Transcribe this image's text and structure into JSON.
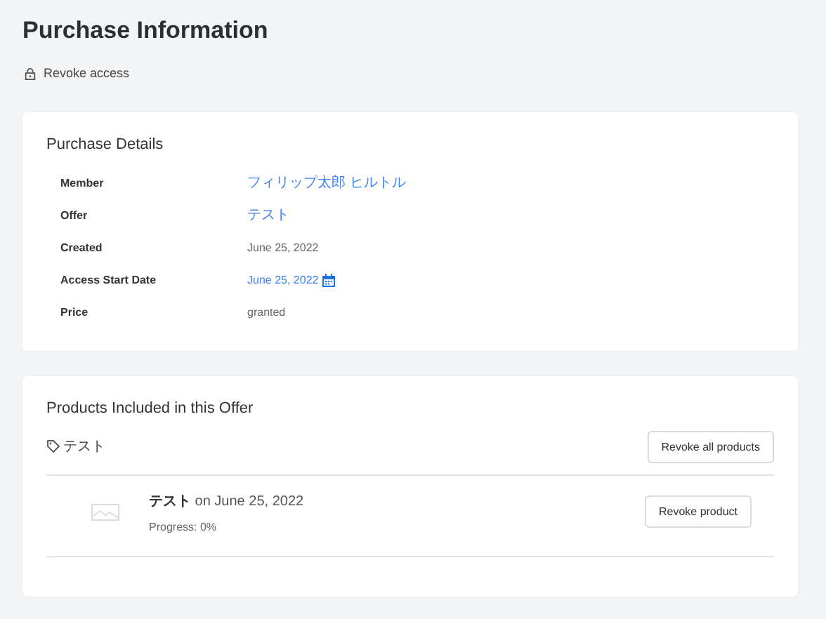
{
  "page": {
    "title": "Purchase Information",
    "revoke_access": "Revoke access"
  },
  "purchase_details": {
    "title": "Purchase Details",
    "rows": [
      {
        "label": "Member",
        "value": "フィリップ太郎 ヒルトル",
        "kind": "link"
      },
      {
        "label": "Offer",
        "value": "テスト",
        "kind": "link"
      },
      {
        "label": "Created",
        "value": "June 25, 2022",
        "kind": "text"
      },
      {
        "label": "Access Start Date",
        "value": "June 25, 2022",
        "kind": "date"
      },
      {
        "label": "Price",
        "value": "granted",
        "kind": "text"
      }
    ]
  },
  "products": {
    "title": "Products Included in this Offer",
    "tag": "テスト",
    "revoke_all": "Revoke all products",
    "items": [
      {
        "name": "テスト",
        "date": "on June 25, 2022",
        "progress": "Progress: 0%",
        "button": "Revoke product"
      }
    ]
  }
}
